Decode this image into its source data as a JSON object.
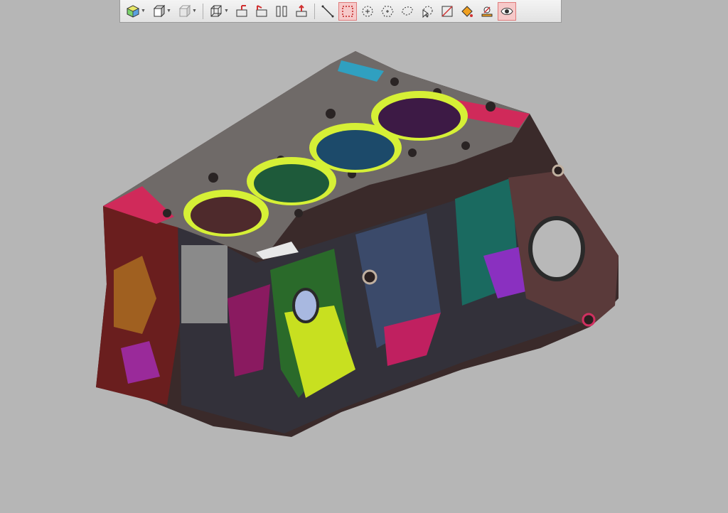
{
  "toolbar": {
    "buttons": [
      {
        "name": "view-orientation-button",
        "icon": "orientation-cube-icon"
      },
      {
        "name": "display-mode-button",
        "icon": "shaded-cube-icon"
      },
      {
        "name": "render-style-button",
        "icon": "flat-cube-icon"
      },
      {
        "name": "wireframe-button",
        "icon": "wireframe-cube-icon"
      },
      {
        "name": "section-x-button",
        "icon": "section-x-icon"
      },
      {
        "name": "section-y-button",
        "icon": "section-y-icon"
      },
      {
        "name": "section-z-button",
        "icon": "section-z-icon"
      },
      {
        "name": "clip-plane-button",
        "icon": "clip-plane-icon"
      },
      {
        "name": "line-select-button",
        "icon": "line-select-icon"
      },
      {
        "name": "rectangle-select-button",
        "icon": "rectangle-select-icon",
        "active": true
      },
      {
        "name": "circle-select-button",
        "icon": "circle-select-icon"
      },
      {
        "name": "polygon-select-button",
        "icon": "polygon-select-icon"
      },
      {
        "name": "lasso-select-button",
        "icon": "lasso-select-icon"
      },
      {
        "name": "point-select-button",
        "icon": "point-select-icon"
      },
      {
        "name": "surface-select-button",
        "icon": "surface-select-icon"
      },
      {
        "name": "paint-select-button",
        "icon": "paint-bucket-icon"
      },
      {
        "name": "brush-select-button",
        "icon": "brush-icon"
      },
      {
        "name": "visibility-toggle-button",
        "icon": "eye-icon",
        "active": true
      }
    ]
  },
  "colors": {
    "background": "#b6b6b6",
    "deck": "#6f6a68",
    "bore_ring": "#d6f036",
    "bore_1": "#4e2a2c",
    "bore_2": "#1e5a3a",
    "bore_3": "#1c4a6a",
    "bore_4": "#3d1a45",
    "accent_active": "#e07b7b"
  }
}
